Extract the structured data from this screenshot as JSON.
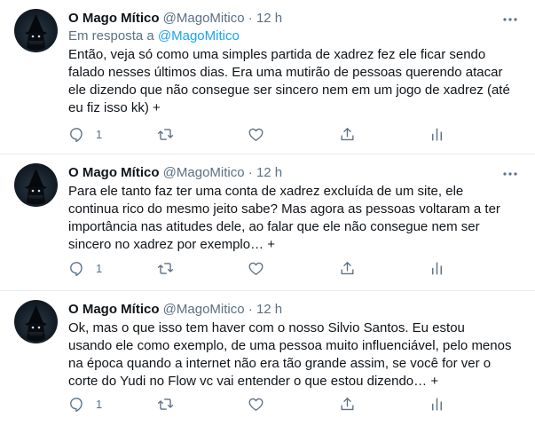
{
  "tweets": [
    {
      "author": {
        "name": "O Mago Mítico",
        "handle": "@MagoMitico"
      },
      "separator": "·",
      "time": "12 h",
      "reply_to": {
        "prefix": "Em resposta a",
        "handle": "@MagoMitico"
      },
      "text": "Então, veja só como uma simples partida de xadrez fez ele ficar sendo falado nesses últimos dias. Era uma mutirão de pessoas querendo atacar ele dizendo que não consegue ser sincero nem em um jogo de xadrez (até eu fiz isso kk) +",
      "reply_count": "1"
    },
    {
      "author": {
        "name": "O Mago Mítico",
        "handle": "@MagoMitico"
      },
      "separator": "·",
      "time": "12 h",
      "text": "Para ele tanto faz ter uma conta de xadrez excluída de um site, ele continua rico do mesmo jeito sabe? Mas agora as pessoas voltaram a ter importância nas atitudes dele, ao falar que ele não consegue nem ser sincero no xadrez por exemplo… +",
      "reply_count": "1"
    },
    {
      "author": {
        "name": "O Mago Mítico",
        "handle": "@MagoMitico"
      },
      "separator": "·",
      "time": "12 h",
      "text": "Ok, mas o que isso tem haver com o nosso Silvio Santos. Eu estou usando ele como exemplo, de uma pessoa muito influenciável, pelo menos na época quando a internet não era tão grande assim, se você for ver o corte do Yudi no Flow vc vai entender o que estou dizendo… +",
      "reply_count": "1"
    }
  ],
  "icons": {
    "more": "more-icon",
    "reply": "reply-icon",
    "retweet": "retweet-icon",
    "like": "like-icon",
    "share": "share-icon",
    "analytics": "analytics-icon"
  },
  "colors": {
    "text": "#0f1419",
    "secondary": "#5b7083",
    "link": "#1da1f2",
    "divider": "#e6ecf0"
  }
}
